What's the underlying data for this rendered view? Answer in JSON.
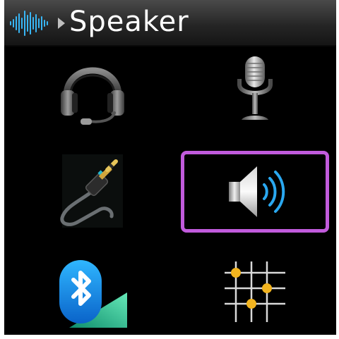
{
  "header": {
    "title": "Speaker",
    "app_icon": "audio-waveform-icon",
    "breadcrumb_separator_icon": "chevron-right-icon"
  },
  "audio_outputs": {
    "selected": "speaker",
    "items": [
      {
        "id": "headset",
        "icon": "headset-icon"
      },
      {
        "id": "microphone",
        "icon": "microphone-icon"
      },
      {
        "id": "wired-jack",
        "icon": "audio-jack-icon"
      },
      {
        "id": "speaker",
        "icon": "speaker-icon"
      },
      {
        "id": "bluetooth",
        "icon": "bluetooth-icon"
      },
      {
        "id": "equalizer",
        "icon": "grid-nodes-icon"
      }
    ]
  },
  "colors": {
    "selection_border": "#c15bdc",
    "accent_blue": "#2aa8f0",
    "background": "#000000"
  }
}
